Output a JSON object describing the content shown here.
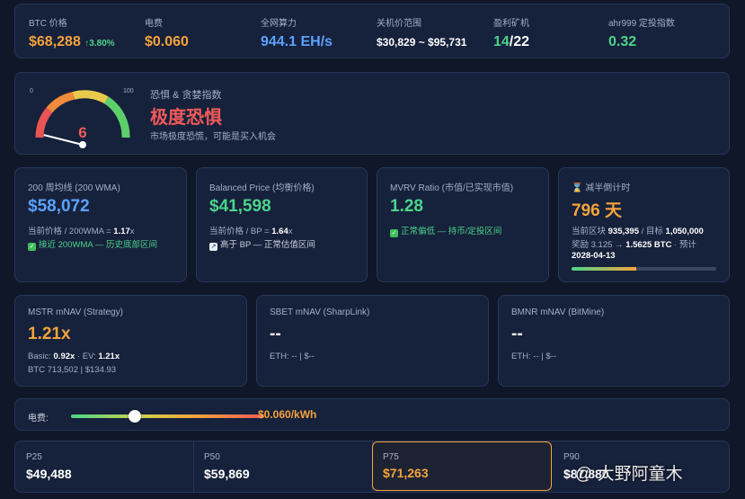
{
  "top_stats": {
    "btc_price": {
      "label": "BTC 价格",
      "value": "$68,288",
      "change": "↑3.80%"
    },
    "electricity": {
      "label": "电费",
      "value": "$0.060"
    },
    "hashrate": {
      "label": "全网算力",
      "value": "944.1 EH/s"
    },
    "shutdown_range": {
      "label": "关机价范围",
      "value": "$30,829 ~ $95,731"
    },
    "profitable_miners": {
      "label": "盈利矿机",
      "value_num": "14",
      "value_den": "/22"
    },
    "ahr999": {
      "label": "ahr999 定投指数",
      "value": "0.32"
    }
  },
  "fear_greed": {
    "min": "0",
    "max": "100",
    "value": "6",
    "value_num": 6,
    "label": "恐惧 & 贪婪指数",
    "status": "极度恐惧",
    "description": "市场极度恐慌，可能是买入机会"
  },
  "metrics": {
    "wma200": {
      "title": "200 周均线 (200 WMA)",
      "value": "$58,072",
      "ratio_prefix": "当前价格 / 200WMA = ",
      "ratio": "1.17",
      "ratio_suffix": "x",
      "note": "接近 200WMA — 历史底部区间"
    },
    "balanced": {
      "title": "Balanced Price (均衡价格)",
      "value": "$41,598",
      "ratio_prefix": "当前价格 / BP = ",
      "ratio": "1.64",
      "ratio_suffix": "x",
      "note": "高于 BP — 正常估值区间"
    },
    "mvrv": {
      "title": "MVRV Ratio (市值/已实现市值)",
      "value": "1.28",
      "note": "正常偏低 — 持币/定投区间"
    },
    "halving": {
      "title": "减半倒计时",
      "value": "796 天",
      "block_prefix": "当前区块 ",
      "block": "935,395",
      "target_prefix": " / 目标 ",
      "target": "1,050,000",
      "reward_prefix": "奖励 3.125 → ",
      "reward": "1.5625 BTC",
      "reward_suffix": " · 预计",
      "date": "2028-04-13",
      "progress": 0.45
    }
  },
  "mnav": {
    "mstr": {
      "title": "MSTR mNAV (Strategy)",
      "value": "1.21x",
      "basic_prefix": "Basic: ",
      "basic": "0.92x",
      "ev_prefix": " · EV: ",
      "ev": "1.21x",
      "holdings": "BTC 713,502 | $134.93"
    },
    "sbet": {
      "title": "SBET mNAV (SharpLink)",
      "value": "--",
      "holdings": "ETH: -- | $--"
    },
    "bmnr": {
      "title": "BMNR mNAV (BitMine)",
      "value": "--",
      "holdings": "ETH: -- | $--"
    }
  },
  "electricity_slider": {
    "label": "电费:",
    "value": "$0.060/kWh",
    "position": 0.33
  },
  "percentiles": [
    {
      "label": "P25",
      "value": "$49,488"
    },
    {
      "label": "P50",
      "value": "$59,869"
    },
    {
      "label": "P75",
      "value": "$71,263"
    },
    {
      "label": "P90",
      "value": "$87,880"
    }
  ],
  "watermark": "@ 大野阿童木",
  "colors": {
    "background": "#0f1729",
    "card": "#16213b",
    "accent_orange": "#f5a33c",
    "accent_green": "#4cd48a",
    "accent_blue": "#5aa2ff",
    "danger_red": "#f05a5a"
  }
}
